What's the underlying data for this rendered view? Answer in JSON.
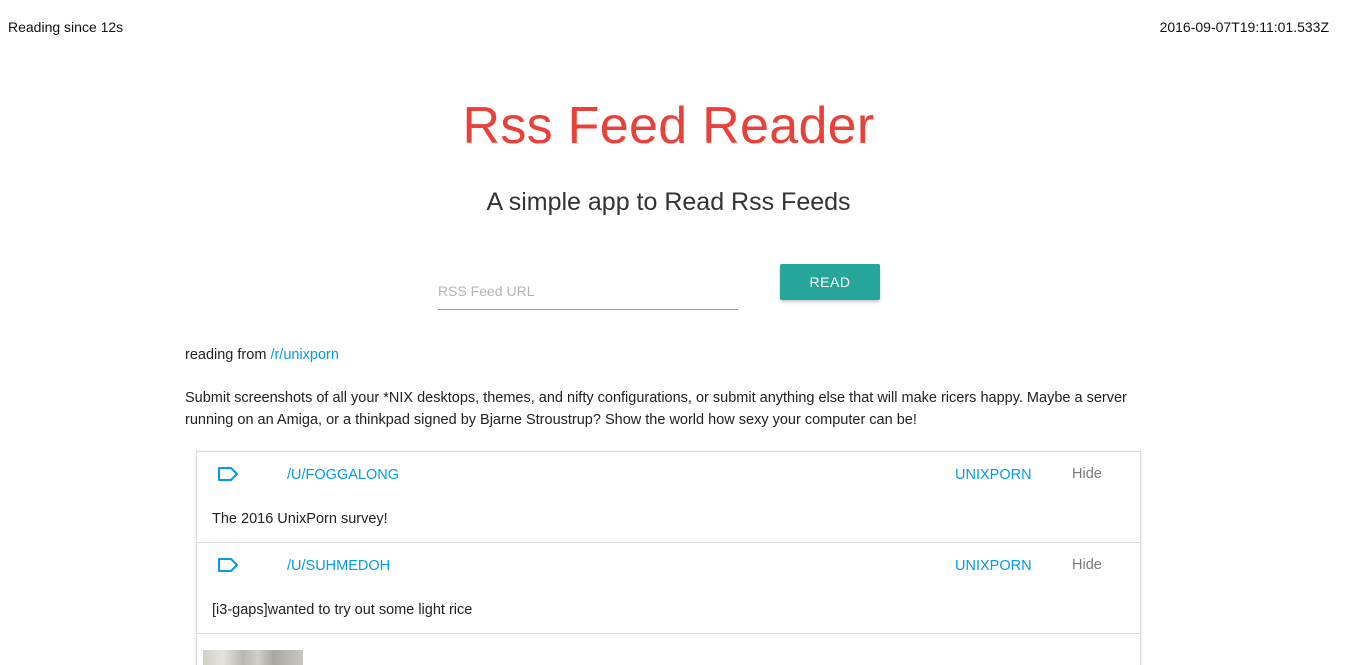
{
  "header": {
    "reading_since": "Reading since 12s",
    "timestamp": "2016-09-07T19:11:01.533Z"
  },
  "hero": {
    "title": "Rss Feed Reader",
    "subtitle": "A simple app to Read Rss Feeds"
  },
  "form": {
    "placeholder": "RSS Feed URL",
    "value": "",
    "read_label": "READ"
  },
  "source": {
    "prefix": "reading from",
    "link": "/r/unixporn",
    "description": "Submit screenshots of all your *NIX desktops, themes, and nifty configurations, or submit anything else that will make ricers happy. Maybe a server running on an Amiga, or a thinkpad signed by Bjarne Stroustrup? Show the world how sexy your computer can be!"
  },
  "colors": {
    "accent": "#e9403a",
    "button": "#26a69a",
    "link": "#039be5"
  },
  "feed": {
    "items": [
      {
        "icon": "tag-icon",
        "author": "/U/FOGGALONG",
        "subreddit": "UNIXPORN",
        "hide_label": "Hide",
        "title": "The 2016 UnixPorn survey!"
      },
      {
        "icon": "tag-icon",
        "author": "/U/SUHMEDOH",
        "subreddit": "UNIXPORN",
        "hide_label": "Hide",
        "title": "[i3-gaps]wanted to try out some light rice"
      }
    ]
  }
}
